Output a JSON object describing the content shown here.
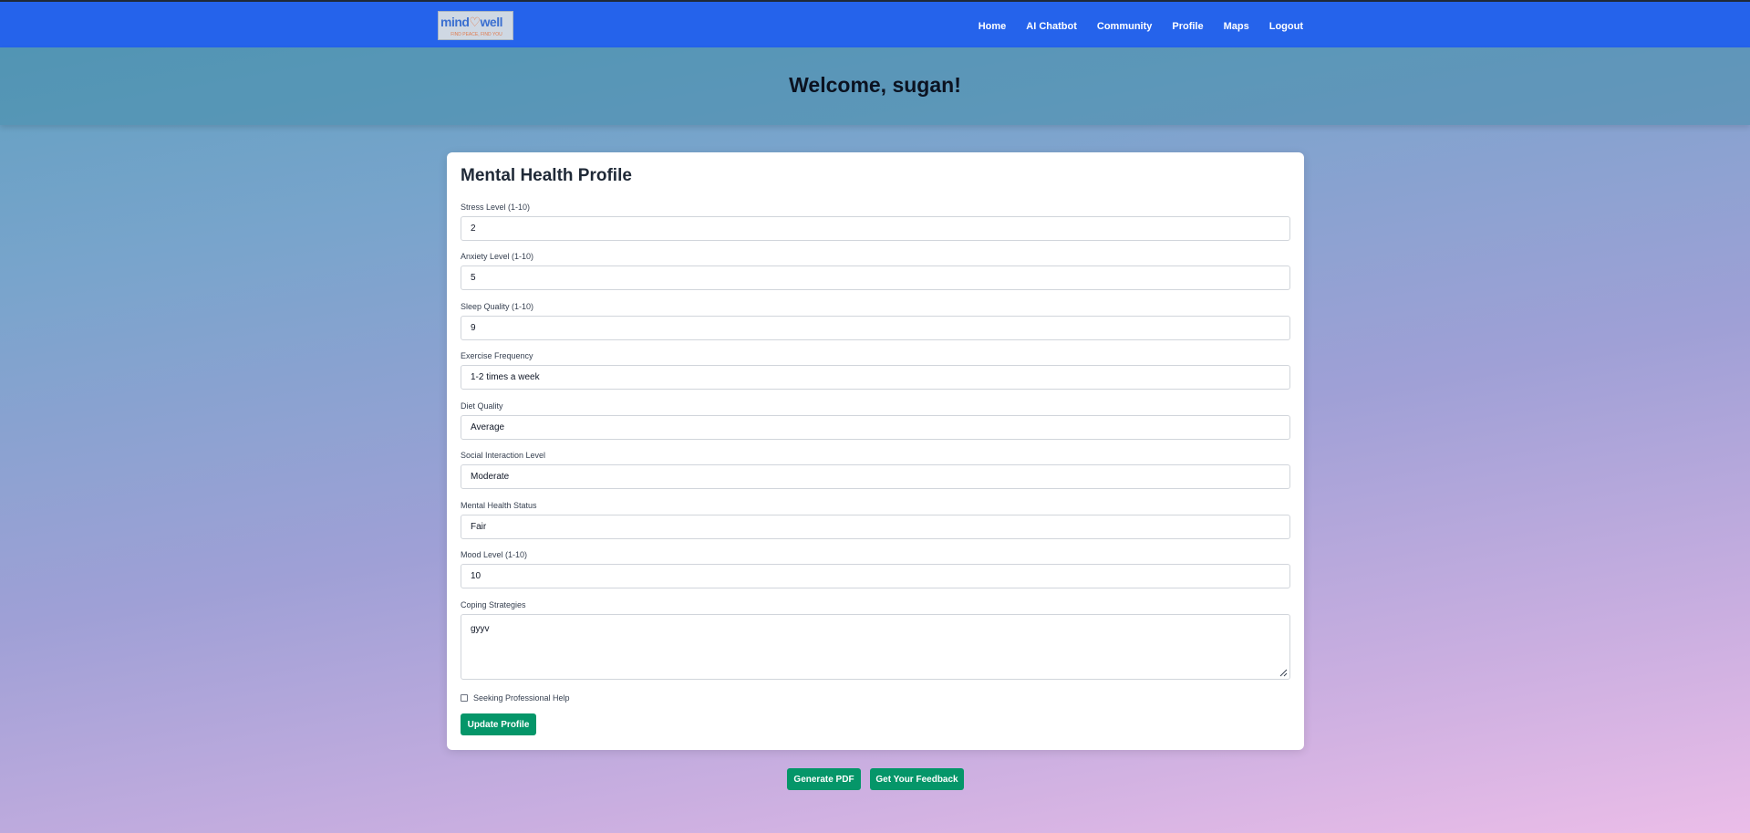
{
  "header": {
    "logo": {
      "name_part1": "mind",
      "name_part2": "well",
      "tagline": "FIND PEACE, FIND YOU"
    },
    "nav": [
      {
        "label": "Home"
      },
      {
        "label": "AI Chatbot"
      },
      {
        "label": "Community"
      },
      {
        "label": "Profile"
      },
      {
        "label": "Maps"
      },
      {
        "label": "Logout"
      }
    ]
  },
  "hero": {
    "welcome_text": "Welcome, sugan!"
  },
  "profile_form": {
    "title": "Mental Health Profile",
    "fields": [
      {
        "label": "Stress Level (1-10)",
        "value": "2"
      },
      {
        "label": "Anxiety Level (1-10)",
        "value": "5"
      },
      {
        "label": "Sleep Quality (1-10)",
        "value": "9"
      },
      {
        "label": "Exercise Frequency",
        "value": "1-2 times a week"
      },
      {
        "label": "Diet Quality",
        "value": "Average"
      },
      {
        "label": "Social Interaction Level",
        "value": "Moderate"
      },
      {
        "label": "Mental Health Status",
        "value": "Fair"
      },
      {
        "label": "Mood Level (1-10)",
        "value": "10"
      }
    ],
    "coping": {
      "label": "Coping Strategies",
      "value": "gyyv"
    },
    "seeking_help": {
      "label": "Seeking Professional Help",
      "checked": false
    },
    "update_button": "Update Profile"
  },
  "actions": {
    "generate_pdf": "Generate PDF",
    "get_feedback": "Get Your Feedback"
  },
  "colors": {
    "navbar": "#2563eb",
    "button": "#059669",
    "heading": "#1f2937"
  }
}
